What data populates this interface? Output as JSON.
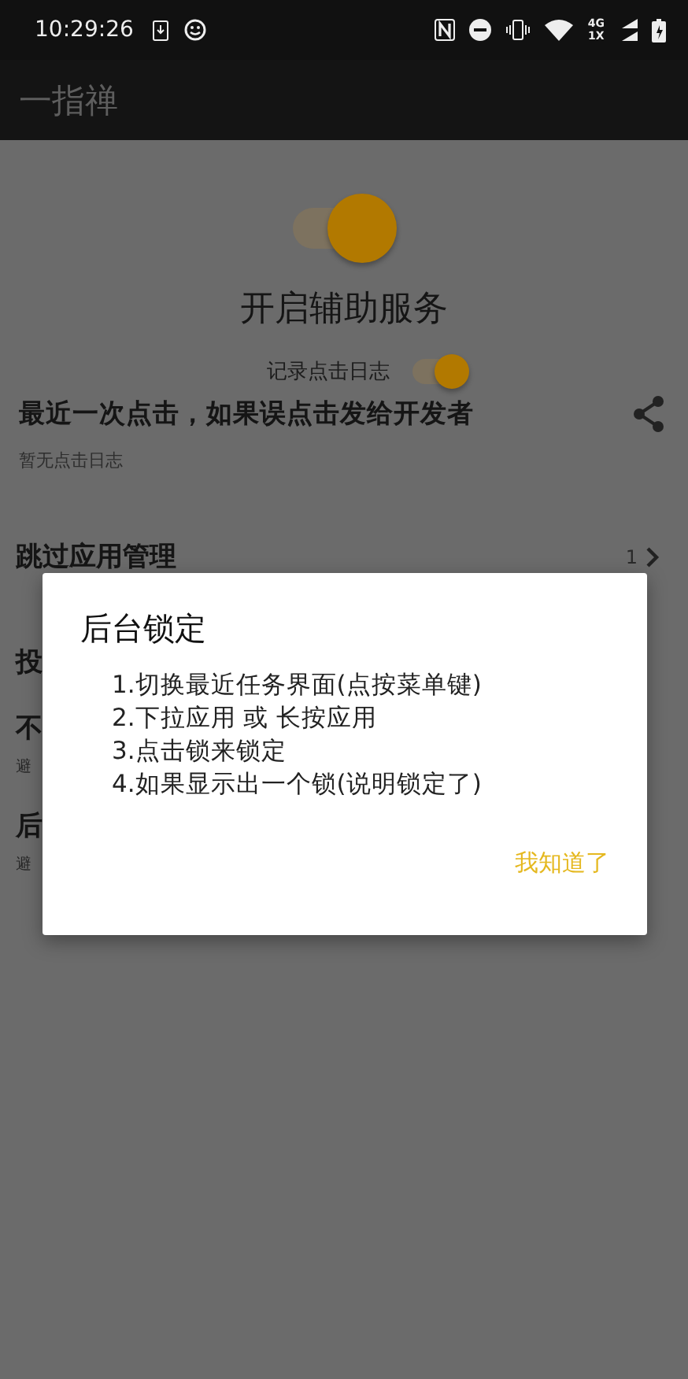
{
  "status_bar": {
    "time": "10:29:26",
    "network_top": "4G",
    "network_bottom": "1X"
  },
  "app_bar": {
    "title": "一指禅"
  },
  "service": {
    "label": "开启辅助服务",
    "on": true
  },
  "log_switch": {
    "label": "记录点击日志",
    "on": true
  },
  "last_click": {
    "title": "最近一次点击，如果误点击发给开发者",
    "empty_text": "暂无点击日志"
  },
  "rows": [
    {
      "title": "跳过应用管理",
      "count": "1"
    },
    {
      "title": "投"
    },
    {
      "title": "不",
      "subtitle": "避"
    },
    {
      "title": "后",
      "subtitle": "避"
    }
  ],
  "dialog": {
    "title": "后台锁定",
    "steps": [
      "1.切换最近任务界面(点按菜单键)",
      "2.下拉应用 或 长按应用",
      "3.点击锁来锁定",
      "4.如果显示出一个锁(说明锁定了)"
    ],
    "button": "我知道了"
  }
}
